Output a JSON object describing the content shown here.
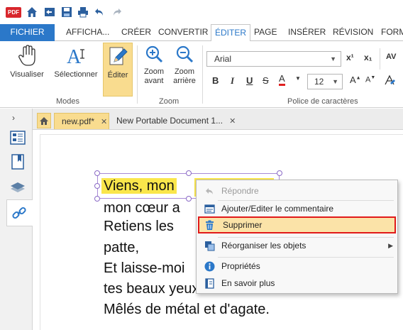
{
  "quick_access": {
    "logo": "PDF",
    "icons": [
      "home-icon",
      "open-folder-icon",
      "save-icon",
      "print-icon",
      "undo-icon",
      "redo-icon"
    ]
  },
  "ribbon_tabs": [
    "FICHIER",
    "AFFICHA...",
    "CRÉER",
    "CONVERTIR",
    "ÉDITER",
    "PAGE",
    "INSÉRER",
    "RÉVISION",
    "FORM"
  ],
  "active_tab": "ÉDITER",
  "ribbon": {
    "modes": {
      "label": "Modes",
      "visualiser": "Visualiser",
      "selectionner": "Sélectionner",
      "editer": "Éditer"
    },
    "zoom": {
      "label": "Zoom",
      "zoom_in_line1": "Zoom",
      "zoom_in_line2": "avant",
      "zoom_out_line1": "Zoom",
      "zoom_out_line2": "arrière"
    },
    "font": {
      "label": "Police de caractères",
      "family": "Arial",
      "size": "12",
      "superscript": "x¹",
      "subscript": "x₁",
      "spacing": "AV"
    }
  },
  "document_tabs": [
    {
      "label": "new.pdf*",
      "close": "✕"
    },
    {
      "label": "New Portable Document 1...",
      "close": "✕"
    }
  ],
  "document_text": {
    "line1": "Viens, mon",
    "line2": "mon cœur a",
    "line3": "Retiens les",
    "line4": "patte,",
    "line5": "Et laisse-moi",
    "line6": "tes beaux yeux",
    "line7": "Mêlés de métal et d'agate."
  },
  "context_menu": {
    "repondre": "Répondre",
    "ajouter": "Ajouter/Editer le commentaire",
    "supprimer": "Supprimer",
    "reorganiser": "Réorganiser les objets",
    "proprietes": "Propriétés",
    "en_savoir_plus": "En savoir plus"
  },
  "colors": {
    "file_tab": "#2b78c9",
    "highlight": "#fae64b",
    "selected_button": "#f9dc8f",
    "menu_highlight_border": "#e11a1a"
  }
}
